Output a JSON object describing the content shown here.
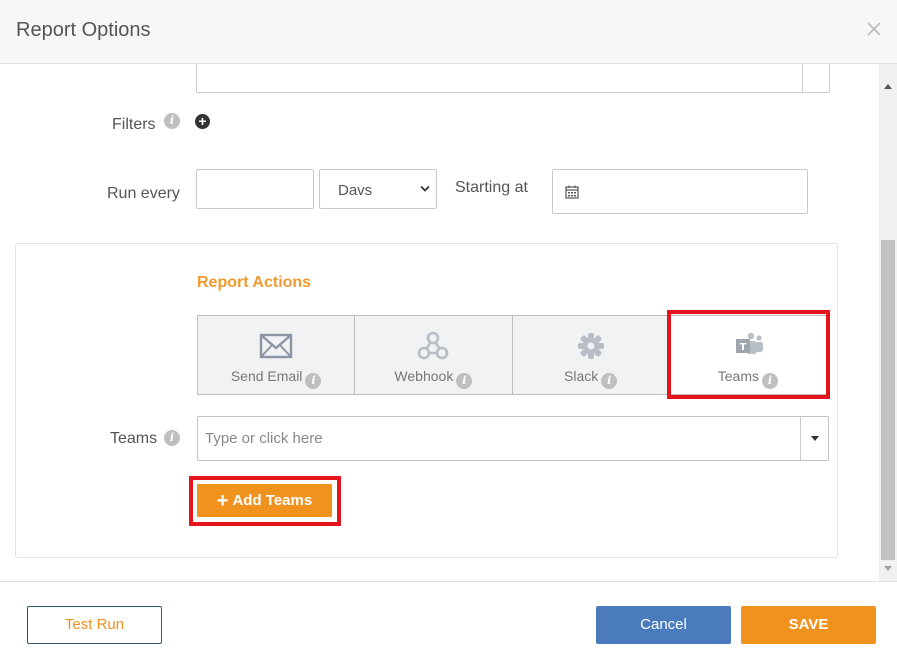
{
  "dialog": {
    "title": "Report Options"
  },
  "form": {
    "filters_label": "Filters",
    "run_every_label": "Run every",
    "run_every_value": "",
    "interval_selected": "Davs",
    "starting_at_label": "Starting at",
    "starting_at_value": ""
  },
  "report_actions": {
    "title": "Report Actions",
    "options": [
      {
        "label": "Send Email",
        "icon": "envelope-icon"
      },
      {
        "label": "Webhook",
        "icon": "webhook-icon"
      },
      {
        "label": "Slack",
        "icon": "slack-icon"
      },
      {
        "label": "Teams",
        "icon": "teams-icon"
      }
    ],
    "selected": "Teams"
  },
  "teams": {
    "label": "Teams",
    "placeholder": "Type or click here",
    "add_button": "Add Teams"
  },
  "footer": {
    "test_run": "Test Run",
    "cancel": "Cancel",
    "save": "SAVE"
  },
  "colors": {
    "accent_orange": "#f0921e",
    "primary_blue": "#4a7bbd",
    "highlight_red": "#e3141c"
  }
}
